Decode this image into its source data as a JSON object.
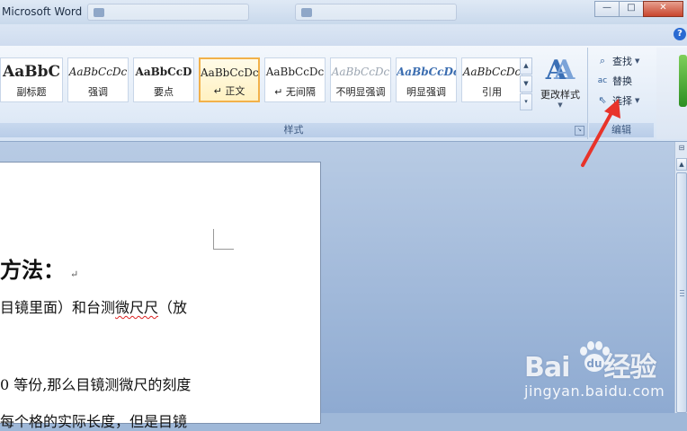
{
  "window": {
    "title": "Microsoft Word",
    "ghost_tabs": [
      "",
      ""
    ],
    "minimize": "—",
    "maximize": "□",
    "close": "✕"
  },
  "help": "?",
  "styles_group": {
    "label": "样式",
    "tiles": [
      {
        "sample": "AaBbC",
        "name": "副标题"
      },
      {
        "sample": "AaBbCcDc",
        "name": "强调"
      },
      {
        "sample": "AaBbCcD",
        "name": "要点"
      },
      {
        "sample": "AaBbCcDc",
        "name": "↵ 正文"
      },
      {
        "sample": "AaBbCcDc",
        "name": "↵ 无间隔"
      },
      {
        "sample": "AaBbCcDc",
        "name": "不明显强调"
      },
      {
        "sample": "AaBbCcDc",
        "name": "明显强调"
      },
      {
        "sample": "AaBbCcDc",
        "name": "引用"
      }
    ],
    "active_tile_index": 3,
    "change_styles_label": "更改样式"
  },
  "edit_group": {
    "label": "编辑",
    "find": "查找",
    "replace": "替换",
    "select": "选择"
  },
  "document": {
    "heading": "方法：",
    "para_mark": "↵",
    "line1_a": "目镜里面）和台测",
    "line1_b": "微尺尺",
    "line1_c": "（放",
    "line2": "0 等份,那么目镜测微尺的刻度",
    "line3": "每个格的实际长度，但是目镜"
  },
  "watermark": {
    "logo_left": "Bai",
    "logo_right": "经验",
    "url": "jingyan.baidu.com"
  },
  "colors": {
    "accent": "#3a6fb5",
    "annotation": "#e8332a",
    "active_tile_border": "#f2b14a"
  }
}
